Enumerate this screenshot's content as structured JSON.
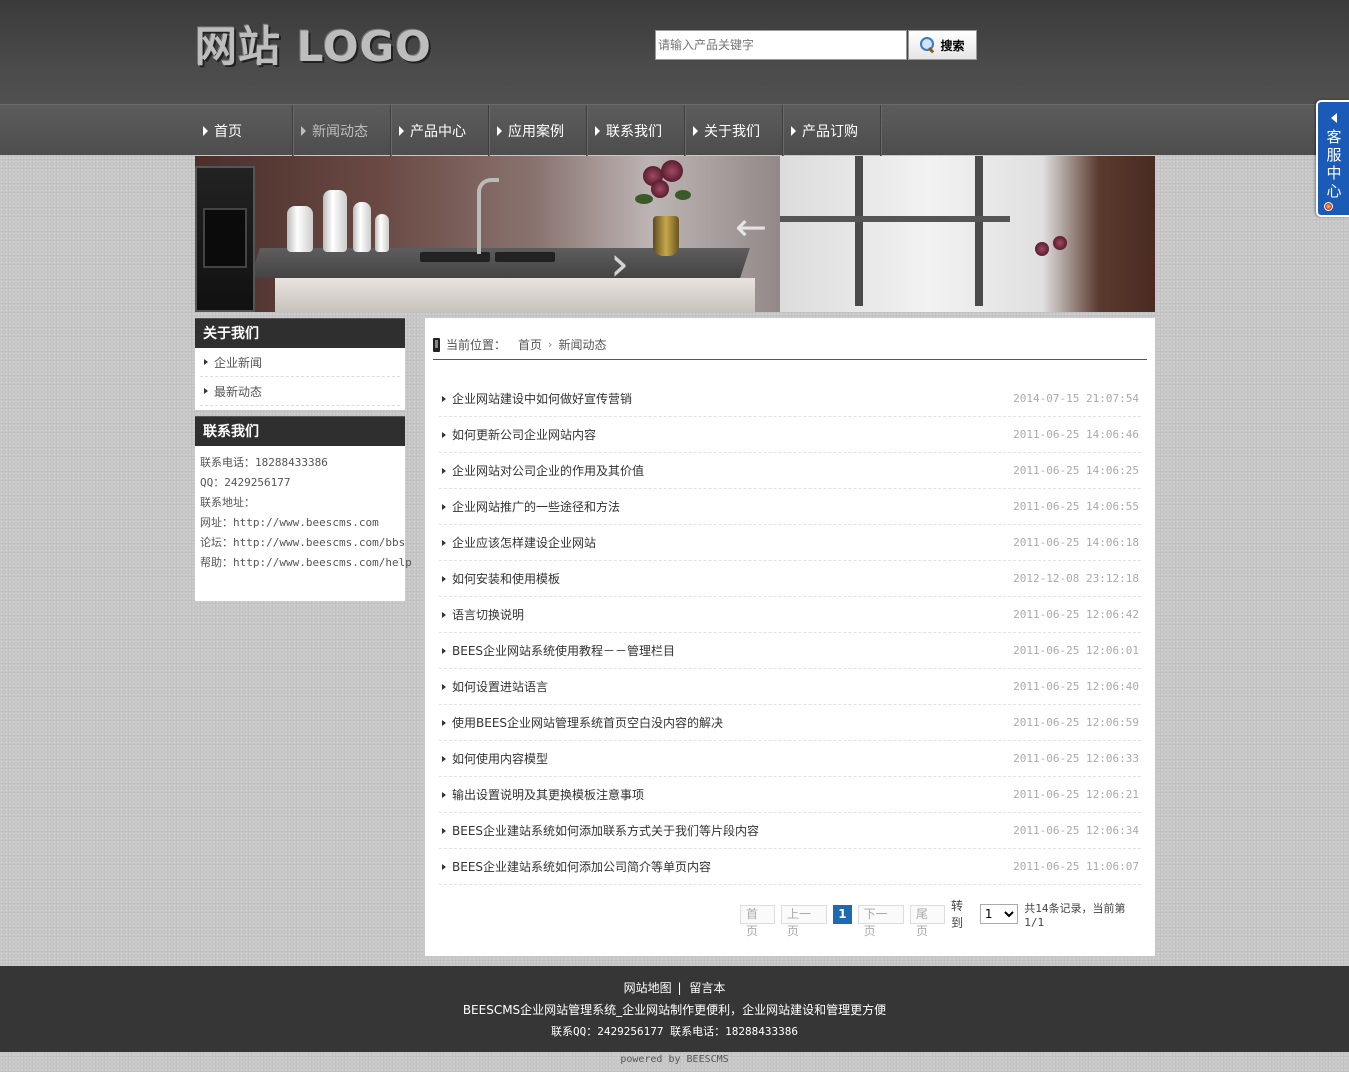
{
  "header": {
    "logo_text": "网站 LOGO",
    "search_placeholder": "请输入产品关键字",
    "search_button": "搜索"
  },
  "nav": {
    "items": [
      {
        "label": "首页"
      },
      {
        "label": "新闻动态"
      },
      {
        "label": "产品中心"
      },
      {
        "label": "应用案例"
      },
      {
        "label": "联系我们"
      },
      {
        "label": "关于我们"
      },
      {
        "label": "产品订购"
      }
    ],
    "active_label": "新闻动态"
  },
  "kefu": {
    "label": "客服中心"
  },
  "sidebar": {
    "about": {
      "title": "关于我们",
      "items": [
        {
          "label": "企业新闻"
        },
        {
          "label": "最新动态"
        }
      ]
    },
    "contact": {
      "title": "联系我们",
      "lines": [
        "联系电话：18288433386",
        "QQ：2429256177",
        "联系地址：",
        "网址：http://www.beescms.com",
        "论坛：http://www.beescms.com/bbs",
        "帮助：http://www.beescms.com/help"
      ]
    }
  },
  "breadcrumb": {
    "prefix": "当前位置：",
    "items": [
      "首页",
      "新闻动态"
    ]
  },
  "news": [
    {
      "title": "企业网站建设中如何做好宣传营销",
      "date": "2014-07-15 21:07:54"
    },
    {
      "title": "如何更新公司企业网站内容",
      "date": "2011-06-25 14:06:46"
    },
    {
      "title": "企业网站对公司企业的作用及其价值",
      "date": "2011-06-25 14:06:25"
    },
    {
      "title": "企业网站推广的一些途径和方法",
      "date": "2011-06-25 14:06:55"
    },
    {
      "title": "企业应该怎样建设企业网站",
      "date": "2011-06-25 14:06:18"
    },
    {
      "title": "如何安装和使用模板",
      "date": "2012-12-08 23:12:18"
    },
    {
      "title": "语言切换说明",
      "date": "2011-06-25 12:06:42"
    },
    {
      "title": "BEES企业网站系统使用教程－－管理栏目",
      "date": "2011-06-25 12:06:01"
    },
    {
      "title": "如何设置进站语言",
      "date": "2011-06-25 12:06:40"
    },
    {
      "title": "使用BEES企业网站管理系统首页空白没内容的解决",
      "date": "2011-06-25 12:06:59"
    },
    {
      "title": "如何使用内容模型",
      "date": "2011-06-25 12:06:33"
    },
    {
      "title": "输出设置说明及其更换模板注意事项",
      "date": "2011-06-25 12:06:21"
    },
    {
      "title": "BEES企业建站系统如何添加联系方式关于我们等片段内容",
      "date": "2011-06-25 12:06:34"
    },
    {
      "title": "BEES企业建站系统如何添加公司简介等单页内容",
      "date": "2011-06-25 11:06:07"
    }
  ],
  "pager": {
    "first": "首页",
    "prev": "上一页",
    "current": "1",
    "next": "下一页",
    "last": "尾页",
    "goto_label": "转到",
    "goto_value": "1",
    "summary": "共14条记录，当前第1/1"
  },
  "footer": {
    "link_sitemap": "网站地图",
    "separator": "|",
    "link_guestbook": "留言本",
    "slogan": "BEESCMS企业网站管理系统_企业网站制作更便利，企业网站建设和管理更方便",
    "contact": "联系QQ：2429256177 联系电话：18288433386",
    "powered": "powered by BEESCMS"
  },
  "colors": {
    "accent": "#1d6ab0",
    "kefu": "#1a5bb8",
    "dark": "#2f2f2f",
    "footer": "#363636"
  }
}
